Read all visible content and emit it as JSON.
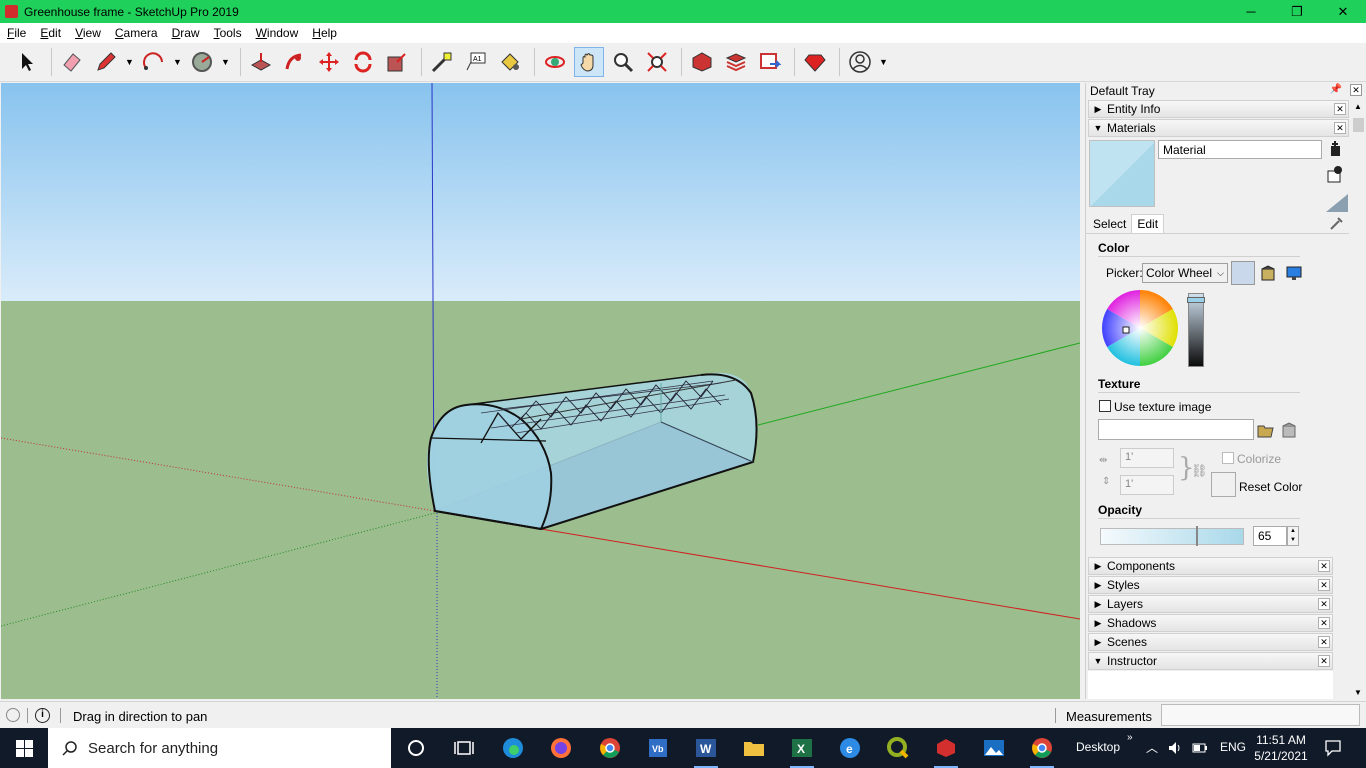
{
  "window": {
    "title": "Greenhouse frame - SketchUp Pro 2019",
    "minimize_glyph": "─",
    "restore_glyph": "❐",
    "close_glyph": "✕"
  },
  "menu": [
    "File",
    "Edit",
    "View",
    "Camera",
    "Draw",
    "Tools",
    "Window",
    "Help"
  ],
  "toolbar": {
    "tools": [
      "select",
      "eraser",
      "pencil-line",
      "arc",
      "shape",
      "push-pull",
      "follow-me",
      "move",
      "rotate",
      "scale",
      "tape-measure",
      "text",
      "paint-bucket",
      "orbit",
      "pan",
      "zoom",
      "zoom-extents",
      "3d-warehouse",
      "extension-warehouse",
      "layout-send",
      "extension-manager",
      "account"
    ],
    "active_tool": "pan"
  },
  "tray": {
    "title": "Default Tray",
    "panels_top": [
      {
        "label": "Entity Info",
        "expanded": false
      },
      {
        "label": "Materials",
        "expanded": true
      }
    ],
    "materials": {
      "name_value": "Material",
      "swatch_color": "#a8d8ea",
      "tabs": [
        "Select",
        "Edit"
      ],
      "active_tab": "Edit",
      "color_heading": "Color",
      "picker_label": "Picker:",
      "picker_value": "Color Wheel",
      "current_color": "#c9d8ea",
      "texture_heading": "Texture",
      "use_texture_label": "Use texture image",
      "texture_width": "1'",
      "texture_height": "1'",
      "colorize_label": "Colorize",
      "reset_color_label": "Reset Color",
      "opacity_heading": "Opacity",
      "opacity_value": "65"
    },
    "panels_bottom": [
      {
        "label": "Components",
        "expanded": false
      },
      {
        "label": "Styles",
        "expanded": false
      },
      {
        "label": "Layers",
        "expanded": false
      },
      {
        "label": "Shadows",
        "expanded": false
      },
      {
        "label": "Scenes",
        "expanded": false
      },
      {
        "label": "Instructor",
        "expanded": true
      }
    ]
  },
  "status": {
    "message": "Drag in direction to pan",
    "measurements_label": "Measurements",
    "measurements_value": ""
  },
  "taskbar": {
    "search_placeholder": "Search for anything",
    "apps": [
      "cortana",
      "task-view",
      "edge",
      "firefox",
      "chrome",
      "virtualbox",
      "word",
      "file-explorer",
      "excel",
      "app-e",
      "qgis",
      "sketchup",
      "photos",
      "chrome-2"
    ],
    "desktop_label": "Desktop",
    "language": "ENG",
    "time": "11:51 AM",
    "date": "5/21/2021"
  },
  "colors": {
    "title_bar": "#1fd15a",
    "sky_top": "#88c3ee",
    "sky_bottom": "#d9ecfa",
    "ground": "#9cbd8e",
    "glass": "#a8d8ea"
  }
}
